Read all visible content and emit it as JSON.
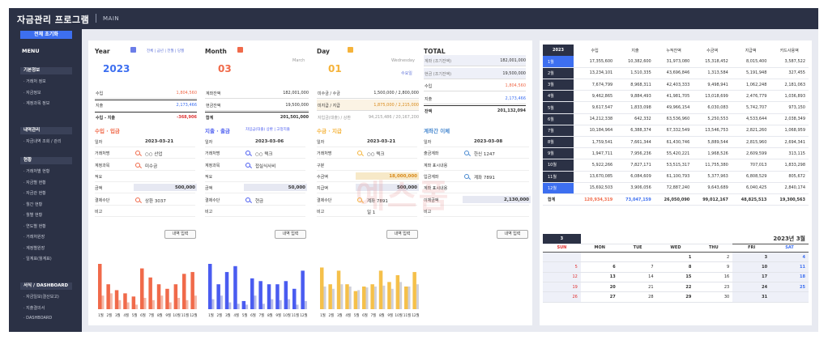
{
  "app": {
    "title": "자금관리 프로그램",
    "subtitle": "MAIN"
  },
  "sidebar": {
    "reset_label": "전체 초기화",
    "menu_label": "MENU",
    "sections": [
      {
        "label": "기본정보",
        "items": [
          "· 거래처 정보",
          "· 자금정보",
          "· 계정과목 정보"
        ]
      },
      {
        "label": "내역관리",
        "items": [
          "· 자금내역 조회 / 관리"
        ]
      },
      {
        "label": "현황",
        "items": [
          "· 거래처별 현황",
          "· 자금별 현황",
          "· 자금관 현황",
          "· 월간 현황",
          "· 월별 현황",
          "· 연도별 현황",
          "· 거래처원장",
          "· 계정별원장",
          "· 일계표(월계표)"
        ]
      },
      {
        "label": "서식 / DASHBOARD",
        "items": [
          "· 자금일보(결산보고)",
          "· 지출결의서",
          "· DASHBOARD"
        ]
      }
    ]
  },
  "summary": {
    "year": {
      "label": "Year",
      "filters": "전체 | 금년 | 전월 | 당월",
      "value": "2023",
      "rows": [
        [
          "수입",
          "1,804,560"
        ],
        [
          "지출",
          "2,173,466"
        ],
        [
          "수입 - 지출",
          "-368,906"
        ]
      ]
    },
    "month": {
      "label": "Month",
      "value": "03",
      "sub": "March",
      "rows": [
        [
          "계좌잔액",
          "182,001,000"
        ],
        [
          "현금잔액",
          "19,500,000"
        ],
        [
          "합계",
          "201,501,000"
        ]
      ]
    },
    "day": {
      "label": "Day",
      "value": "01",
      "sub": "Wednesday",
      "rows": [
        [
          "미수금 / 수금",
          "1,500,000 / 2,800,000"
        ],
        [
          "미지급 / 지급",
          "1,875,000 / 2,215,000"
        ],
        [
          "자입금(대출) / 상환",
          "94,215,486 / 20,167,200"
        ]
      ]
    },
    "total": {
      "label": "TOTAL",
      "sublabel": "수요일",
      "rows": [
        [
          "계좌 (조기잔액)",
          "182,001,000"
        ],
        [
          "현금 (조기잔액)",
          "19,500,000"
        ],
        [
          "수입",
          "1,804,560"
        ],
        [
          "지출",
          "2,173,466"
        ],
        [
          "잔액",
          "201,132,094"
        ]
      ]
    }
  },
  "entry": {
    "button": "내역 입력",
    "forms": [
      {
        "title": "수입 · 입금",
        "rows": [
          [
            "일자",
            "2023-03-21"
          ],
          [
            "거래처명",
            "○○ 산업"
          ],
          [
            "계정과목",
            "미수금"
          ],
          [
            "적요",
            ""
          ],
          [
            "금액",
            "500,000"
          ],
          [
            "결제수단",
            "상환 3037"
          ],
          [
            "비고",
            ""
          ]
        ]
      },
      {
        "title": "지출 · 출금",
        "links": "차입금(대출) 상환 | 고정지출",
        "rows": [
          [
            "일자",
            "2023-03-06"
          ],
          [
            "거래처명",
            "○○ 텍크"
          ],
          [
            "계정과목",
            "접실식사비"
          ],
          [
            "적요",
            ""
          ],
          [
            "금액",
            "50,000"
          ],
          [
            "결제수단",
            "현금"
          ],
          [
            "비고",
            ""
          ]
        ]
      },
      {
        "title": "수금 · 지급",
        "rows": [
          [
            "일자",
            "2023-03-21"
          ],
          [
            "거래처명",
            "○○ 텍크"
          ],
          [
            "구분",
            ""
          ],
          [
            "수금액",
            "18,000,000"
          ],
          [
            "지급액",
            "500,000"
          ],
          [
            "결제수단",
            "계좌 7891"
          ],
          [
            "비고",
            "일 1"
          ]
        ]
      },
      {
        "title": "계좌간 이체",
        "rows": [
          [
            "일자",
            "2023-03-08"
          ],
          [
            "출금계좌",
            "한신 1247"
          ],
          [
            "계좌 표시내용",
            ""
          ],
          [
            "입금계좌",
            "계좌 7891"
          ],
          [
            "계좌 표시내용",
            ""
          ],
          [
            "이체금액",
            "2,130,000"
          ],
          [
            "비고",
            ""
          ]
        ]
      }
    ]
  },
  "charts": {
    "months": [
      "1월",
      "2월",
      "3월",
      "4월",
      "5월",
      "6월",
      "7월",
      "8월",
      "9월",
      "10월",
      "11월",
      "12월"
    ]
  },
  "chart_data": [
    {
      "type": "bar",
      "series": [
        {
          "values": [
            1.0,
            0.55,
            0.42,
            0.35,
            0.28,
            0.9,
            0.7,
            0.55,
            0.45,
            0.55,
            0.78,
            0.82
          ],
          "color": "#f06a4a"
        },
        {
          "values": [
            0.3,
            0.35,
            0.2,
            0.15,
            0.1,
            0.25,
            0.2,
            0.3,
            0.15,
            0.25,
            0.2,
            0.3
          ],
          "color": "#f4b8a8"
        }
      ]
    },
    {
      "type": "bar",
      "series": [
        {
          "values": [
            1.0,
            0.55,
            0.82,
            0.95,
            0.18,
            0.68,
            0.62,
            0.55,
            0.55,
            0.62,
            0.45,
            0.85
          ],
          "color": "#4a5cf0"
        },
        {
          "values": [
            0.22,
            0.3,
            0.15,
            0.12,
            0.1,
            0.3,
            0.12,
            0.22,
            0.2,
            0.22,
            0.1,
            0.18
          ],
          "color": "#b8bdea"
        }
      ]
    },
    {
      "type": "bar",
      "series": [
        {
          "values": [
            0.92,
            0.55,
            0.85,
            0.55,
            0.4,
            0.5,
            0.55,
            0.85,
            0.6,
            0.75,
            0.5,
            0.82
          ],
          "color": "#f5c04a"
        },
        {
          "values": [
            0.5,
            0.45,
            0.55,
            0.5,
            0.42,
            0.48,
            0.5,
            0.52,
            0.45,
            0.6,
            0.5,
            0.55
          ],
          "color": "#d0d0d8"
        }
      ]
    }
  ],
  "table": {
    "year": "2023",
    "headers": [
      "수입",
      "지출",
      "누적잔액",
      "수금액",
      "지급액",
      "카드사용액"
    ],
    "rows": [
      [
        "1월",
        "17,355,600",
        "10,382,600",
        "31,973,080",
        "15,318,452",
        "8,015,400",
        "3,587,522"
      ],
      [
        "2월",
        "13,234,101",
        "1,510,335",
        "43,696,846",
        "1,313,584",
        "5,191,948",
        "327,455"
      ],
      [
        "3월",
        "7,674,799",
        "8,968,311",
        "42,403,333",
        "9,498,941",
        "1,062,248",
        "2,181,063"
      ],
      [
        "4월",
        "9,462,865",
        "9,884,493",
        "41,981,705",
        "13,018,699",
        "2,476,779",
        "1,036,893"
      ],
      [
        "5월",
        "9,617,547",
        "1,833,098",
        "49,966,154",
        "6,030,083",
        "5,742,707",
        "973,150"
      ],
      [
        "6월",
        "14,212,338",
        "642,332",
        "63,536,960",
        "5,250,553",
        "4,533,644",
        "2,038,349"
      ],
      [
        "7월",
        "10,184,964",
        "6,388,374",
        "67,332,549",
        "13,546,753",
        "2,821,260",
        "1,068,959"
      ],
      [
        "8월",
        "1,759,541",
        "7,661,344",
        "61,430,746",
        "5,889,544",
        "2,815,960",
        "2,694,341"
      ],
      [
        "9월",
        "1,947,711",
        "7,956,236",
        "55,420,221",
        "1,968,526",
        "2,609,599",
        "313,115"
      ],
      [
        "10월",
        "5,922,266",
        "7,827,171",
        "53,515,317",
        "11,755,380",
        "707,013",
        "1,833,298"
      ],
      [
        "11월",
        "13,670,085",
        "6,084,609",
        "61,100,793",
        "5,377,963",
        "6,808,529",
        "805,672"
      ],
      [
        "12월",
        "15,692,503",
        "3,906,056",
        "72,887,240",
        "9,643,689",
        "6,040,425",
        "2,840,174"
      ]
    ],
    "total": [
      "합계",
      "120,934,319",
      "73,047,159",
      "26,050,090",
      "99,012,167",
      "48,825,513",
      "19,300,563"
    ]
  },
  "calendar": {
    "month_no": "3",
    "title": "2023년 3월",
    "days": [
      "SUN",
      "MON",
      "TUE",
      "WED",
      "THU",
      "FRI",
      "SAT"
    ],
    "weeks": [
      [
        "",
        "",
        "",
        "1",
        "2",
        "3",
        "4"
      ],
      [
        "5",
        "6",
        "7",
        "8",
        "9",
        "10",
        "11"
      ],
      [
        "12",
        "13",
        "14",
        "15",
        "16",
        "17",
        "18"
      ],
      [
        "19",
        "20",
        "21",
        "22",
        "23",
        "24",
        "25"
      ],
      [
        "26",
        "27",
        "28",
        "29",
        "30",
        "31",
        ""
      ]
    ]
  },
  "watermark": "예스폼"
}
